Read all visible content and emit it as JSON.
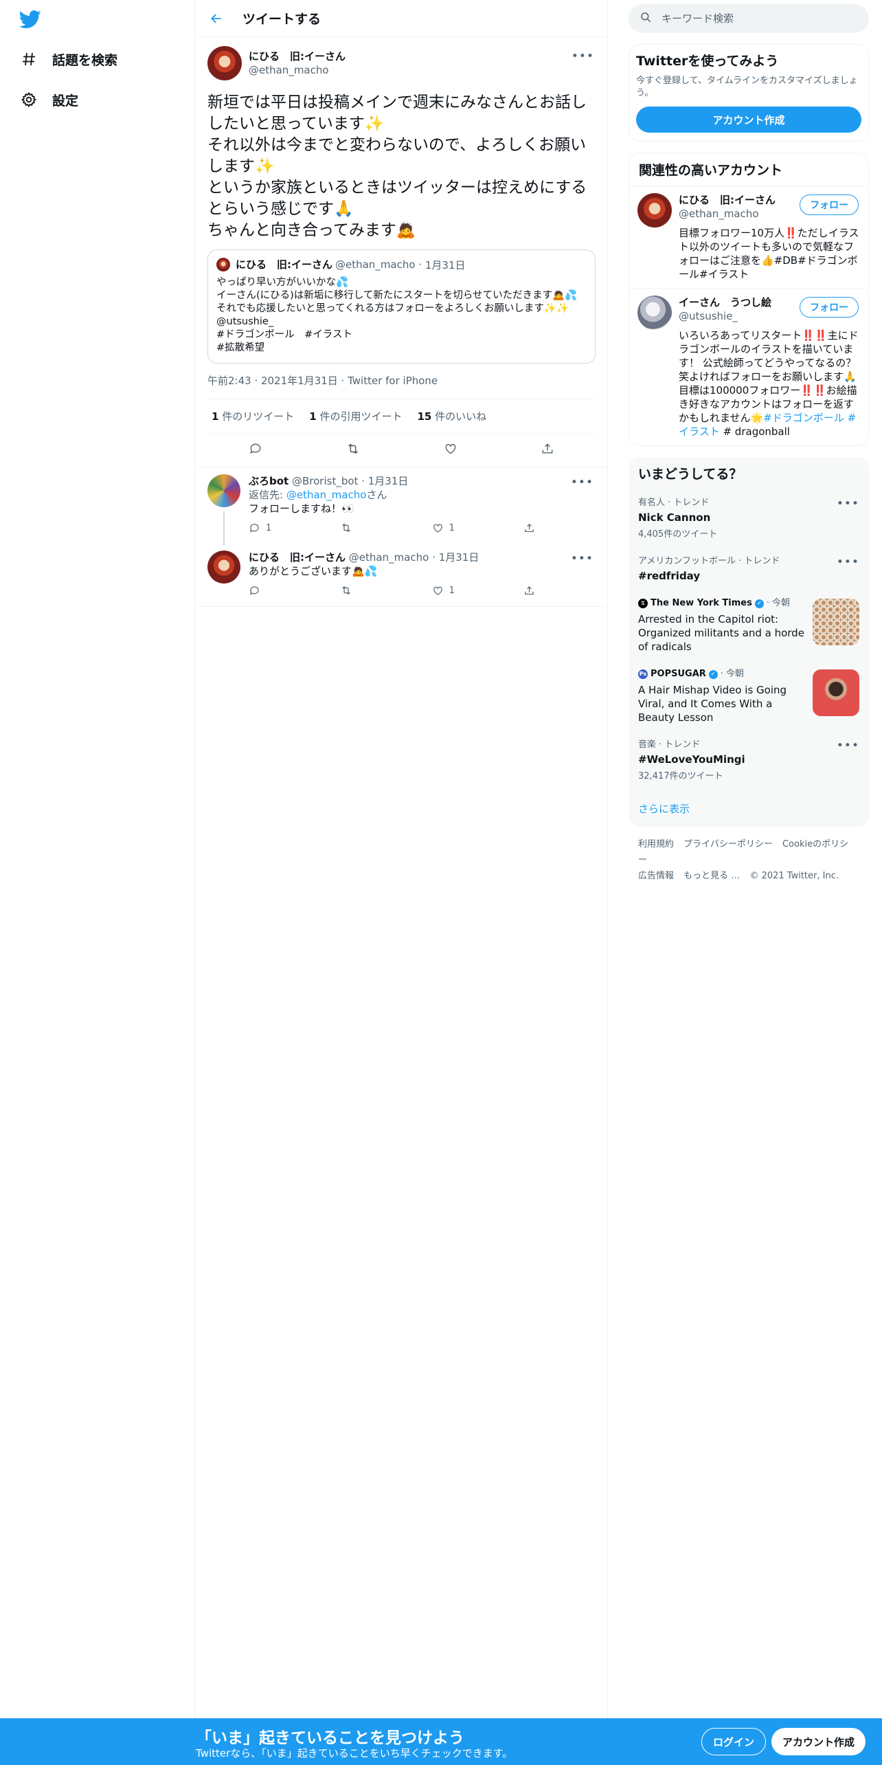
{
  "brand": {
    "accent": "#1d9bf0",
    "icon": "twitter-bird-icon"
  },
  "nav": {
    "items": [
      {
        "label": "話題を検索",
        "icon": "hashtag-icon"
      },
      {
        "label": "設定",
        "icon": "gear-icon"
      }
    ]
  },
  "header": {
    "title": "ツイートする"
  },
  "tweet": {
    "name": "にひる　旧:イーさん",
    "handle": "@ethan_macho",
    "text": "新垣では平日は投稿メインで週末にみなさんとお話ししたいと思っています✨\nそれ以外は今までと変わらないので、よろしくお願いします✨\nというか家族といるときはツイッターは控えめにするとらいう感じです🙏\nちゃんと向き合ってみます🙇",
    "quote": {
      "name": "にひる　旧:イーさん",
      "handle": "@ethan_macho",
      "date": "1月31日",
      "text": "やっぱり早い方がいいかな💦\nイーさん(にひる)は新垢に移行して新たにスタートを切らせていただきます🙇💦\nそれでも応援したいと思ってくれる方はフォローをよろしくお願いします✨✨\n@utsushie_\n#ドラゴンボール　#イラスト\n#拡散希望"
    },
    "meta": "午前2:43 · 2021年1月31日 · Twitter for iPhone",
    "stats": [
      {
        "count": "1",
        "label": "件のリツイート"
      },
      {
        "count": "1",
        "label": "件の引用ツイート"
      },
      {
        "count": "15",
        "label": "件のいいね"
      }
    ]
  },
  "replies": [
    {
      "name": "ぶろbot",
      "handle": "@Brorist_bot",
      "date": "1月31日",
      "reply_prefix": "返信先: ",
      "reply_to": "@ethan_macho",
      "reply_suffix": "さん",
      "text": "フォローしますね！👀",
      "replies": "1",
      "retweets": "",
      "likes": "1"
    },
    {
      "name": "にひる　旧:イーさん",
      "handle": "@ethan_macho",
      "date": "1月31日",
      "text": "ありがとうございます🙇💦",
      "replies": "",
      "retweets": "",
      "likes": "1"
    }
  ],
  "search": {
    "placeholder": "キーワード検索"
  },
  "signup_card": {
    "title": "Twitterを使ってみよう",
    "desc": "今すぐ登録して、タイムラインをカスタマイズしましょう。",
    "button": "アカウント作成"
  },
  "related": {
    "title": "関連性の高いアカウント",
    "follow_label": "フォロー",
    "accounts": [
      {
        "name": "にひる　旧:イーさん",
        "handle": "@ethan_macho",
        "bio": "目標フォロワー10万人‼️ただしイラスト以外のツイートも多いので気軽なフォローはご注意を👍#DB#ドラゴンボール#イラスト"
      },
      {
        "name": "イーさん　うつし絵",
        "handle": "@utsushie_",
        "bio": "いろいろあってリスタート‼️‼️主にドラゴンボールのイラストを描いています！ 公式絵師ってどうやってなるの？笑よければフォローをお願いします🙏目標は100000フォロワー‼️‼️お絵描き好きなアカウントはフォローを返すかもしれません🌟",
        "bio_tags": "#ドラゴンボール #イラスト",
        "bio_tail": " # dragonball"
      }
    ]
  },
  "trends": {
    "title": "いまどうしてる？",
    "items": [
      {
        "context": "有名人 · トレンド",
        "title": "Nick Cannon",
        "count": "4,405件のツイート"
      },
      {
        "context": "アメリカンフットボール · トレンド",
        "title": "#redfriday",
        "count": ""
      },
      {
        "source": "The New York Times",
        "time": "今朝",
        "headline": "Arrested in the Capitol riot: Organized militants and a horde of radicals"
      },
      {
        "source": "POPSUGAR",
        "time": "今朝",
        "headline": "A Hair Mishap Video is Going Viral, and It Comes With a Beauty Lesson"
      },
      {
        "context": "音楽 · トレンド",
        "title": "#WeLoveYouMingi",
        "count": "32,417件のツイート"
      }
    ],
    "show_more": "さらに表示"
  },
  "footer": {
    "links": [
      "利用規約",
      "プライバシーポリシー",
      "Cookieのポリシー",
      "広告情報",
      "もっと見る …",
      "© 2021 Twitter, Inc."
    ]
  },
  "bottom_bar": {
    "title": "「いま」起きていることを見つけよう",
    "subtitle": "Twitterなら、「いま」起きていることをいち早くチェックできます。",
    "login": "ログイン",
    "signup": "アカウント作成"
  }
}
